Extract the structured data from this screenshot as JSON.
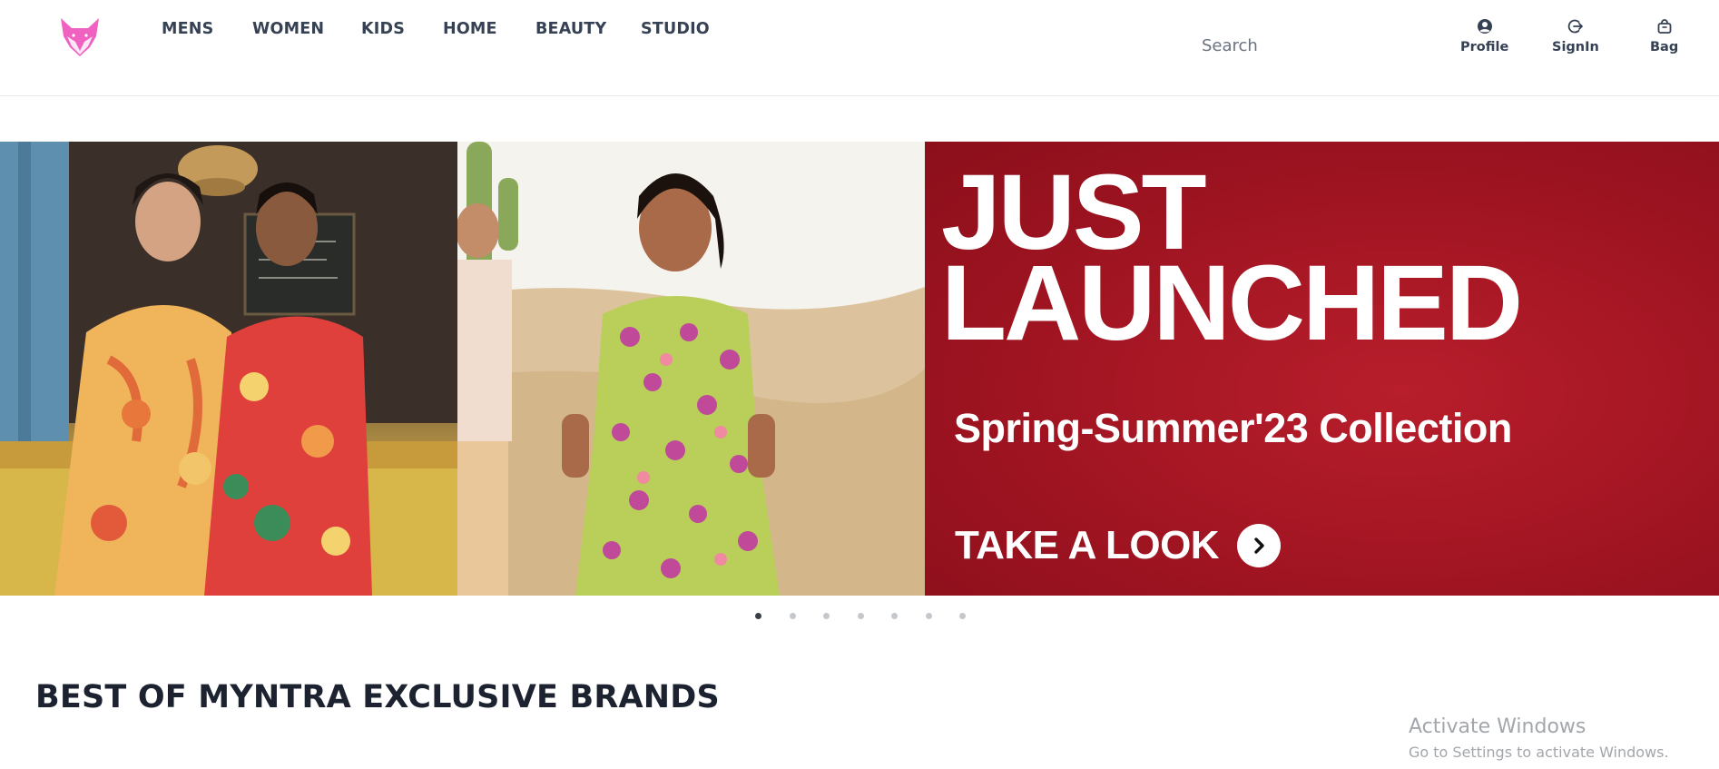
{
  "brand": {
    "logo_icon": "fox-logo-icon",
    "logo_color": "#f062c0"
  },
  "nav": {
    "items": [
      {
        "label": "MENS"
      },
      {
        "label": "WOMEN"
      },
      {
        "label": "KIDS"
      },
      {
        "label": "HOME"
      },
      {
        "label": "BEAUTY"
      },
      {
        "label": "STUDIO"
      }
    ]
  },
  "search": {
    "placeholder": "Search"
  },
  "actions": {
    "profile": {
      "label": "Profile",
      "icon": "user-circle-icon"
    },
    "signin": {
      "label": "SignIn",
      "icon": "sign-in-icon"
    },
    "bag": {
      "label": "Bag",
      "icon": "bag-icon"
    }
  },
  "hero": {
    "headline_1": "JUST",
    "headline_2": "LAUNCHED",
    "subline": "Spring-Summer'23 Collection",
    "cta_label": "TAKE A LOOK",
    "cta_icon": "chevron-right-icon",
    "accent_color": "#a8172a"
  },
  "carousel": {
    "slide_count": 7,
    "active_index": 0
  },
  "section": {
    "title": "BEST OF MYNTRA EXCLUSIVE BRANDS"
  },
  "watermark": {
    "line1": "Activate Windows",
    "line2": "Go to Settings to activate Windows."
  }
}
